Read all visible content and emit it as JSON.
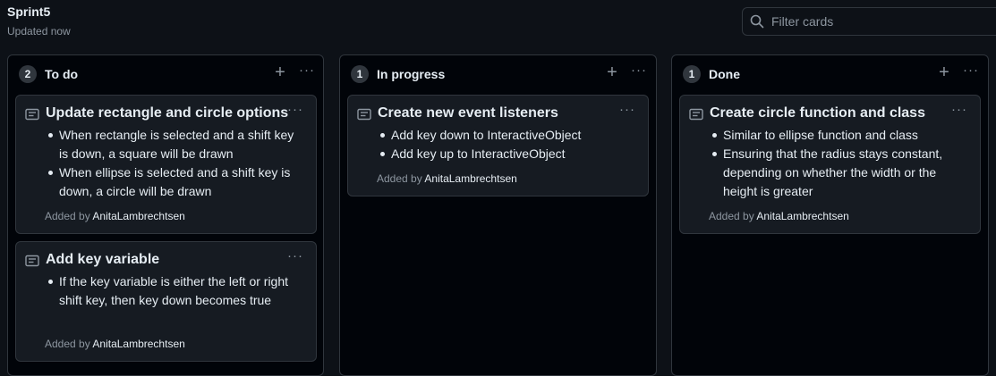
{
  "header": {
    "title": "Sprint5",
    "subtitle": "Updated now",
    "filter_placeholder": "Filter cards"
  },
  "columns": [
    {
      "count": "2",
      "name": "To do",
      "cards": [
        {
          "title": "Update rectangle and circle options",
          "bullets": [
            "When rectangle is selected and a shift key is down, a square will be drawn",
            "When ellipse is selected and a shift key is down, a circle will be drawn"
          ],
          "added_prefix": "Added by",
          "author": "AnitaLambrechtsen"
        },
        {
          "title": "Add key variable",
          "bullets": [
            "If the key variable is either the left or right shift key, then key down becomes true"
          ],
          "added_prefix": "Added by",
          "author": "AnitaLambrechtsen"
        }
      ]
    },
    {
      "count": "1",
      "name": "In progress",
      "cards": [
        {
          "title": "Create new event listeners",
          "bullets": [
            "Add key down to InteractiveObject",
            "Add key up to InteractiveObject"
          ],
          "added_prefix": "Added by",
          "author": "AnitaLambrechtsen"
        }
      ]
    },
    {
      "count": "1",
      "name": "Done",
      "cards": [
        {
          "title": "Create circle function and class",
          "bullets": [
            "Similar to ellipse function and class",
            "Ensuring that the radius stays constant, depending on whether the width or the height is greater"
          ],
          "added_prefix": "Added by",
          "author": "AnitaLambrechtsen"
        }
      ]
    }
  ],
  "icons": {
    "search": "search-icon",
    "add": "plus-icon",
    "more": "kebab-horizontal-icon",
    "note": "note-icon"
  },
  "ui": {
    "add_glyph": "+",
    "more_glyph": "···"
  },
  "colors": {
    "background": "#0d1117",
    "column": "#010409",
    "card": "#161b22",
    "border": "#30363d",
    "muted": "#8d96a0",
    "text": "#e6edf3"
  }
}
